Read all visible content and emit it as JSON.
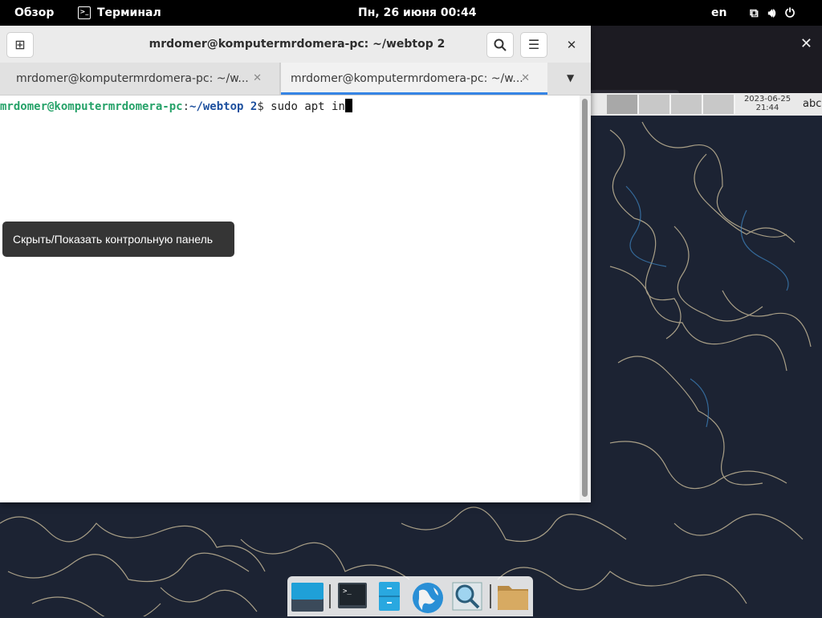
{
  "topbar": {
    "activities": "Обзор",
    "app_name": "Терминал",
    "datetime": "Пн, 26 июня  00:44",
    "lang": "en",
    "icons": [
      "network-icon",
      "volume-icon",
      "power-icon"
    ]
  },
  "terminal": {
    "title": "mrdomer@komputermrdomera-pc: ~/webtop 2",
    "tabs": [
      {
        "label": "mrdomer@komputermrdomera-pc: ~/w...",
        "active": false
      },
      {
        "label": "mrdomer@komputermrdomera-pc: ~/w...",
        "active": true
      }
    ],
    "prompt": {
      "user_host": "mrdomer@komputermrdomera-pc",
      "colon": ":",
      "path": "~/webtop 2",
      "dollar": "$ ",
      "command": "sudo apt in"
    }
  },
  "tooltip": "Скрыть/Показать контрольную панель",
  "browser": {
    "strip_date": "2023-06-25",
    "strip_time": "21:44",
    "strip_text": "abc"
  },
  "dock": {
    "items": [
      "desktop-icon",
      "terminal-icon",
      "file-cabinet-icon",
      "globe-browser-icon",
      "image-search-icon",
      "folder-icon"
    ]
  },
  "colors": {
    "accent": "#3584e4",
    "prompt_user": "#26a269",
    "prompt_path": "#1c4f9e",
    "wallpaper": "#1c2333"
  }
}
